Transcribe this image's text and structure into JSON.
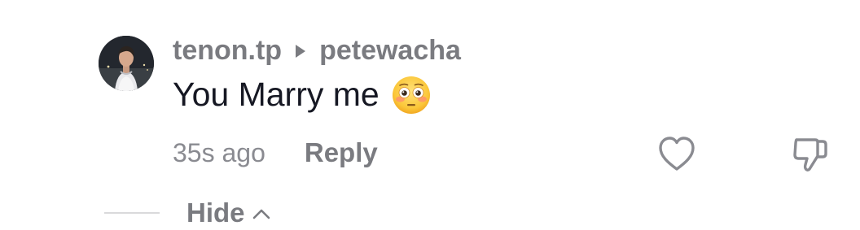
{
  "comment": {
    "username": "tenon.tp",
    "reply_to": "petewacha",
    "text": "You Marry me",
    "emoji": "flushed-face-emoji",
    "timestamp": "35s ago",
    "reply_label": "Reply",
    "hide_label": "Hide"
  },
  "colors": {
    "primary_text": "#161823",
    "secondary_text": "#7a7b80",
    "meta_text": "#8a8b91",
    "divider": "#d9d9db"
  },
  "icons": {
    "reply_arrow": "caret-right-icon",
    "like": "heart-outline-icon",
    "dislike": "thumbs-down-outline-icon",
    "hide": "chevron-up-icon"
  }
}
